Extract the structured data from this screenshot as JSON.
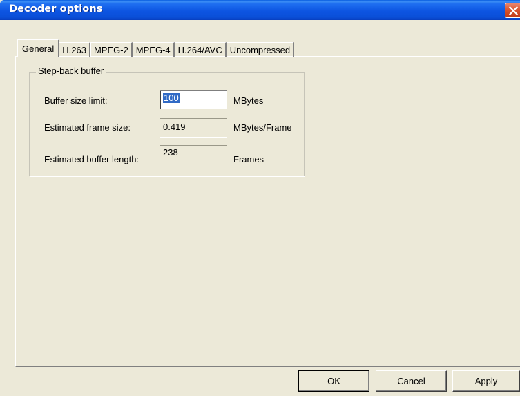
{
  "window": {
    "title": "Decoder options"
  },
  "tabs": [
    {
      "label": "General",
      "active": true
    },
    {
      "label": "H.263",
      "active": false
    },
    {
      "label": "MPEG-2",
      "active": false
    },
    {
      "label": "MPEG-4",
      "active": false
    },
    {
      "label": "H.264/AVC",
      "active": false
    },
    {
      "label": "Uncompressed",
      "active": false
    }
  ],
  "group": {
    "title": "Step-back buffer",
    "buffer_size_limit": {
      "label": "Buffer size limit:",
      "value": "100",
      "unit": "MBytes"
    },
    "estimated_frame_size": {
      "label": "Estimated frame size:",
      "value": "0.419",
      "unit": "MBytes/Frame"
    },
    "estimated_buffer_length": {
      "label": "Estimated buffer length:",
      "value": "238",
      "unit": "Frames"
    }
  },
  "buttons": {
    "ok": "OK",
    "cancel": "Cancel",
    "apply": "Apply"
  },
  "colors": {
    "titlebar": "#0a4fd8",
    "dialog_bg": "#ece9d8",
    "selection": "#316ac5"
  }
}
